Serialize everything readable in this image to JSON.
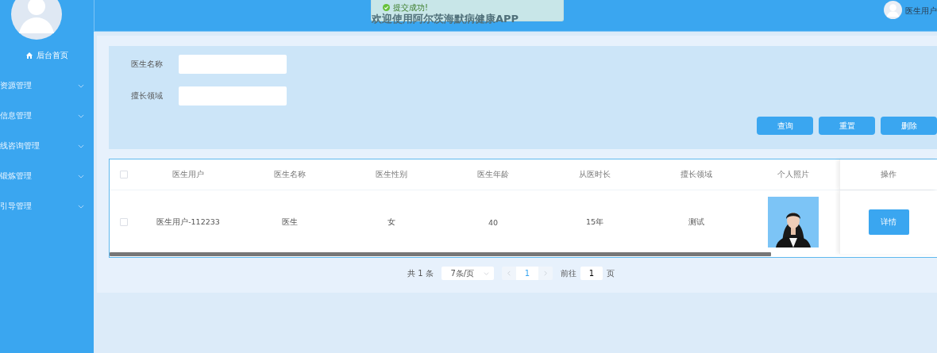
{
  "header": {
    "title": "欢迎使用阿尔茨海默病健康APP",
    "user": "医生用户"
  },
  "toast": {
    "message": "提交成功!"
  },
  "sidebar": {
    "home": "后台首页",
    "items": [
      {
        "label": "资源管理"
      },
      {
        "label": "信息管理"
      },
      {
        "label": "线咨询管理"
      },
      {
        "label": "锻炼管理"
      },
      {
        "label": "引导管理"
      }
    ]
  },
  "search": {
    "fields": [
      {
        "label": "医生名称"
      },
      {
        "label": "擅长领域"
      }
    ],
    "buttons": [
      "查询",
      "重置",
      "删除"
    ]
  },
  "table": {
    "all_checked": false,
    "columns": [
      "医生用户",
      "医生名称",
      "医生性别",
      "医生年龄",
      "从医时长",
      "擅长领域",
      "个人照片",
      "操作"
    ],
    "rows": [
      {
        "checked": false,
        "cells": [
          "医生用户-112233",
          "医生",
          "女",
          "40",
          "15年",
          "测试"
        ],
        "action": "详情"
      }
    ]
  },
  "pagination": {
    "total": "共 1 条",
    "page_size": "7条/页",
    "pages": [
      {
        "label": "1",
        "selected": true
      }
    ],
    "goto_label": "前往",
    "goto_value": "1",
    "suffix": "页"
  }
}
